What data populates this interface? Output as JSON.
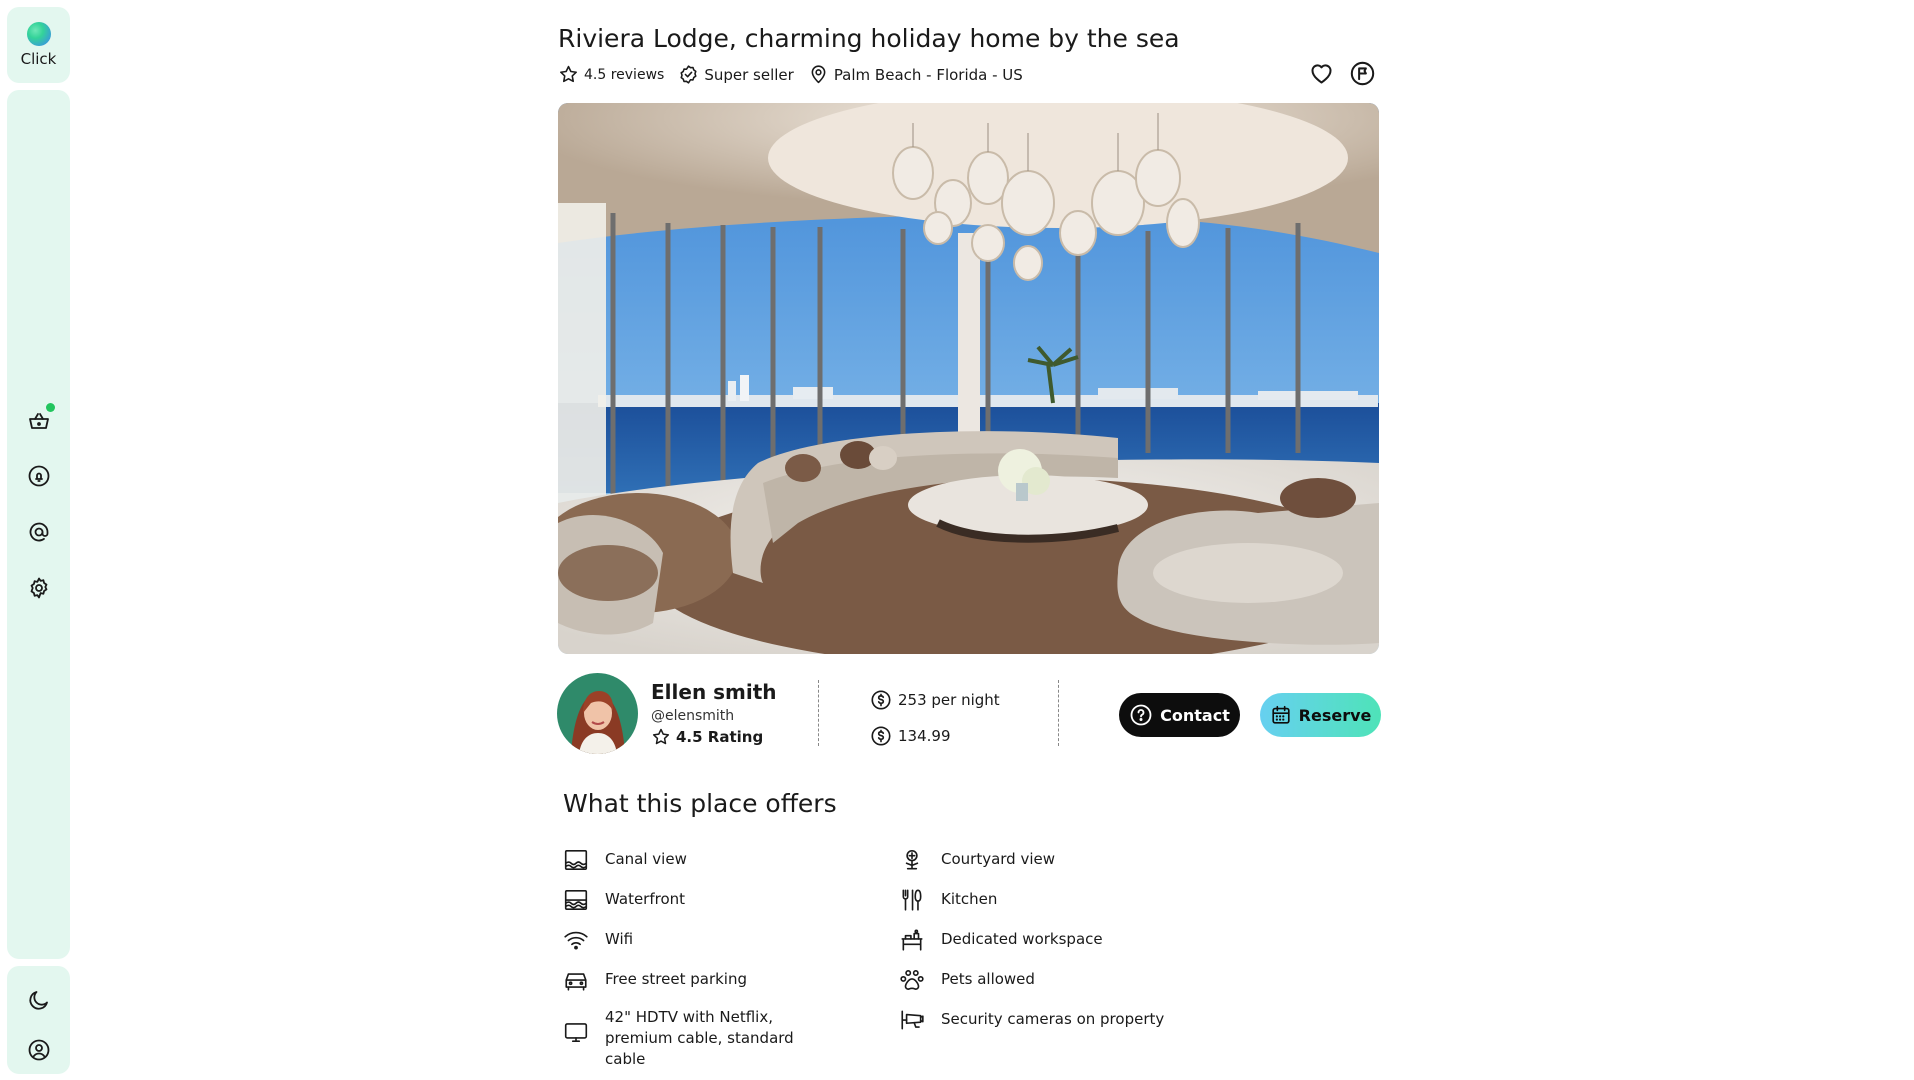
{
  "sidebar": {
    "logo_label": "Click",
    "icons": [
      "basket-icon",
      "bell-icon",
      "at-icon",
      "gear-icon"
    ],
    "bottom_icons": [
      "moon-icon",
      "user-icon"
    ],
    "notification_color": "#22c55e",
    "background": "#e3f7ef"
  },
  "listing": {
    "title": "Riviera Lodge, charming holiday home by the sea",
    "reviews": "4.5 reviews",
    "seller_badge": "Super seller",
    "location": "Palm Beach - Florida - US"
  },
  "host": {
    "name": "Ellen smith",
    "handle": "@elensmith",
    "rating": "4.5 Rating"
  },
  "pricing": {
    "per_night": "253 per night",
    "total": "134.99"
  },
  "buttons": {
    "contact": "Contact",
    "reserve": "Reserve"
  },
  "offers": {
    "title": "What this place offers",
    "left": [
      {
        "label": "Canal view",
        "icon": "canal-view-icon"
      },
      {
        "label": "Waterfront",
        "icon": "waterfront-icon"
      },
      {
        "label": "Wifi",
        "icon": "wifi-icon"
      },
      {
        "label": "Free street parking",
        "icon": "car-icon"
      },
      {
        "label": "42\" HDTV with Netflix, premium cable, standard cable",
        "icon": "tv-icon"
      }
    ],
    "right": [
      {
        "label": "Courtyard view",
        "icon": "courtyard-icon"
      },
      {
        "label": "Kitchen",
        "icon": "kitchen-icon"
      },
      {
        "label": "Dedicated workspace",
        "icon": "workspace-icon"
      },
      {
        "label": "Pets allowed",
        "icon": "paw-icon"
      },
      {
        "label": "Security cameras on property",
        "icon": "camera-icon"
      }
    ]
  },
  "colors": {
    "accent_gradient_start": "#67d0f0",
    "accent_gradient_end": "#4ee3b8",
    "contact_bg": "#0d0d0d"
  }
}
